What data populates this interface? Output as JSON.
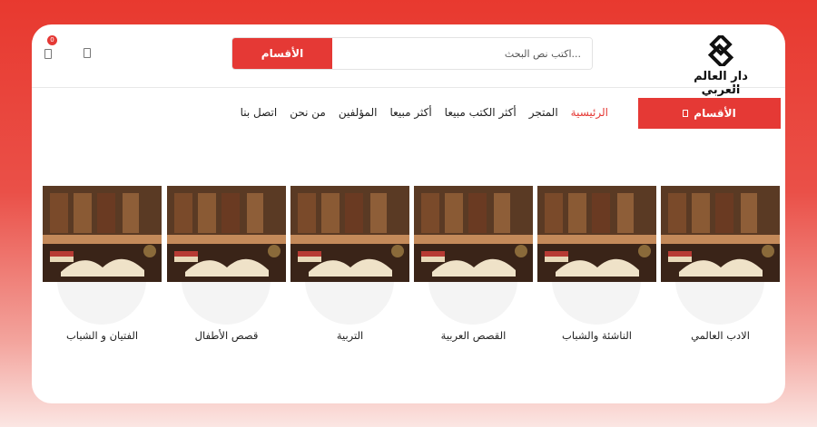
{
  "header": {
    "logo_text": "دار العالم العربي",
    "search_placeholder": "اكتب نص البحث...",
    "search_button": "الأقسام",
    "cart_count": "0"
  },
  "nav": {
    "categories_button": "الأقسام",
    "links": [
      {
        "label": "الرئيسية",
        "active": true
      },
      {
        "label": "المتجر"
      },
      {
        "label": "أكثر الكتب مبيعا"
      },
      {
        "label": "أكثر مبيعا"
      },
      {
        "label": "المؤلفين"
      },
      {
        "label": "من نحن"
      },
      {
        "label": "اتصل بنا"
      }
    ]
  },
  "categories": [
    {
      "label": "الفتيان و الشباب"
    },
    {
      "label": "قصص الأطفال"
    },
    {
      "label": "التربية"
    },
    {
      "label": "القصص العربية"
    },
    {
      "label": "الناشئة والشباب"
    },
    {
      "label": "الادب العالمي"
    }
  ],
  "colors": {
    "accent": "#e53935"
  }
}
